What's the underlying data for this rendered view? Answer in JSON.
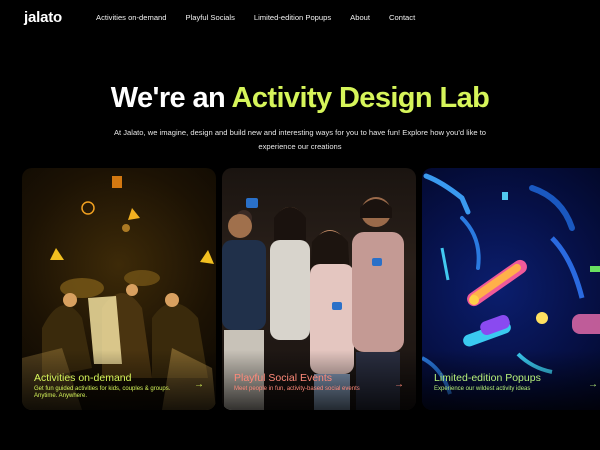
{
  "brand": {
    "logo_text": "jalato",
    "accent_color": "#d6f55a"
  },
  "nav": {
    "items": [
      {
        "label": "Activities on-demand"
      },
      {
        "label": "Playful Socials"
      },
      {
        "label": "Limited-edition Popups"
      },
      {
        "label": "About"
      },
      {
        "label": "Contact"
      }
    ]
  },
  "hero": {
    "title_plain": "We're an ",
    "title_highlight": "Activity Design Lab",
    "subtitle": "At Jalato, we imagine, design and build new and interesting ways for you to have fun! Explore how you'd like to experience our creations"
  },
  "cards": [
    {
      "title": "Activities on-demand",
      "description": "Get fun guided activities for kids, couples & groups. Anytime. Anywhere.",
      "arrow_icon": "arrow-right-icon",
      "color": "#d6f55a"
    },
    {
      "title": "Playful Social Events",
      "description": "Meet people in fun, activity-based social events",
      "arrow_icon": "arrow-right-icon",
      "color": "#ff8a7a"
    },
    {
      "title": "Limited-edition Popups",
      "description": "Experience our wildest activity ideas",
      "arrow_icon": "arrow-right-icon",
      "color": "#b6f07a"
    }
  ]
}
